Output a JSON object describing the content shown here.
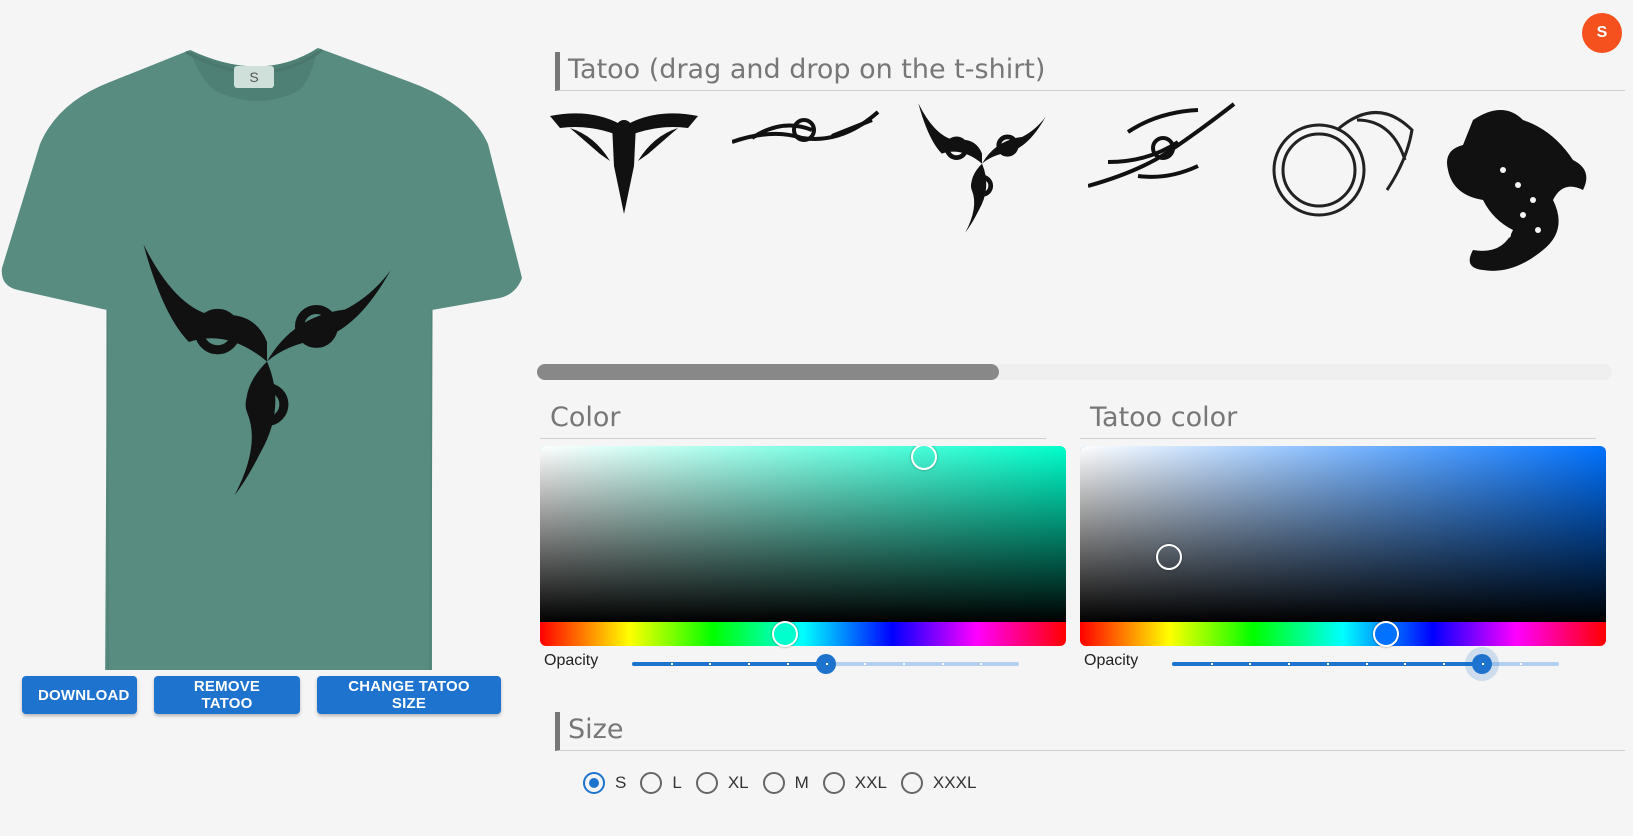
{
  "user": {
    "avatar_initial": "S",
    "avatar_color": "#f4511e"
  },
  "preview": {
    "shirt_color": "#588c80",
    "size_tag": "S",
    "tattoo_color": "#111111",
    "placed_tattoo": "tribal-triskele"
  },
  "actions": {
    "download_label": "DOWNLOAD",
    "remove_label": "REMOVE TATOO",
    "change_size_label": "CHANGE TATOO SIZE"
  },
  "gallery": {
    "title": "Tatoo (drag and drop on the t-shirt)",
    "items": [
      {
        "name": "tribal-eagle"
      },
      {
        "name": "tribal-swirl"
      },
      {
        "name": "tribal-triskele"
      },
      {
        "name": "tribal-flame"
      },
      {
        "name": "dragon-circle"
      },
      {
        "name": "dragon"
      }
    ],
    "scroll_position": 0.43
  },
  "color": {
    "title": "Color",
    "hue_color": "#00ffcc",
    "opacity_label": "Opacity",
    "opacity_value": 0.5
  },
  "tatoo_color": {
    "title": "Tatoo color",
    "hue_color": "#0072ff",
    "opacity_label": "Opacity",
    "opacity_value": 0.8
  },
  "size": {
    "title": "Size",
    "options": [
      "S",
      "L",
      "XL",
      "M",
      "XXL",
      "XXXL"
    ],
    "selected": "S"
  }
}
